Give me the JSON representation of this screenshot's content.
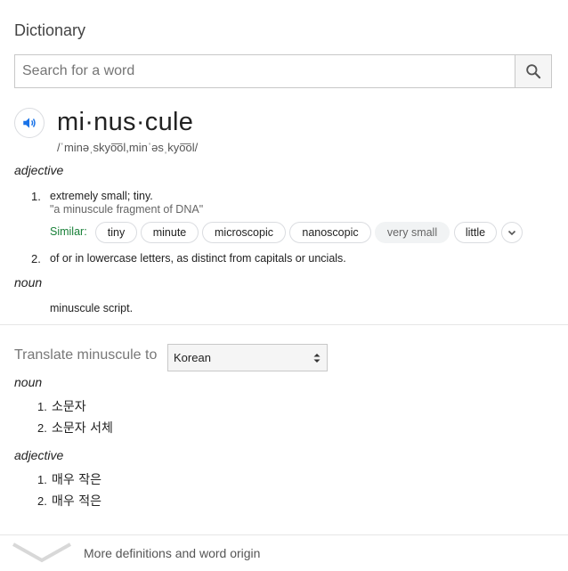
{
  "header": {
    "title": "Dictionary"
  },
  "search": {
    "placeholder": "Search for a word"
  },
  "entry": {
    "word": "mi·nus·cule",
    "phonetic": "/ˈminəˌskyo͞ol,minˈəsˌkyo͞ol/",
    "sections": [
      {
        "pos": "adjective",
        "definitions": [
          {
            "num": "1.",
            "text": "extremely small; tiny.",
            "example": "\"a minuscule fragment of DNA\"",
            "similar_label": "Similar:",
            "similar": [
              "tiny",
              "minute",
              "microscopic",
              "nanoscopic",
              "very small",
              "little"
            ]
          },
          {
            "num": "2.",
            "text": "of or in lowercase letters, as distinct from capitals or uncials."
          }
        ]
      },
      {
        "pos": "noun",
        "definitions": [
          {
            "text": "minuscule script."
          }
        ]
      }
    ]
  },
  "translate": {
    "label": "Translate minuscule to",
    "language": "Korean",
    "noun_label": "noun",
    "noun_items": [
      "소문자",
      "소문자 서체"
    ],
    "adj_label": "adjective",
    "adj_items": [
      "매우 작은",
      "매우 적은"
    ],
    "nums": [
      "1.",
      "2."
    ]
  },
  "footer": {
    "more_label": "More definitions and word origin"
  },
  "icons": {
    "search": "search-icon",
    "speaker": "speaker-icon",
    "expand": "chevron-down-icon",
    "select": "select-arrows-icon",
    "more": "chevron-down-icon"
  },
  "colors": {
    "accent": "#1a73e8",
    "similar": "#188038"
  }
}
